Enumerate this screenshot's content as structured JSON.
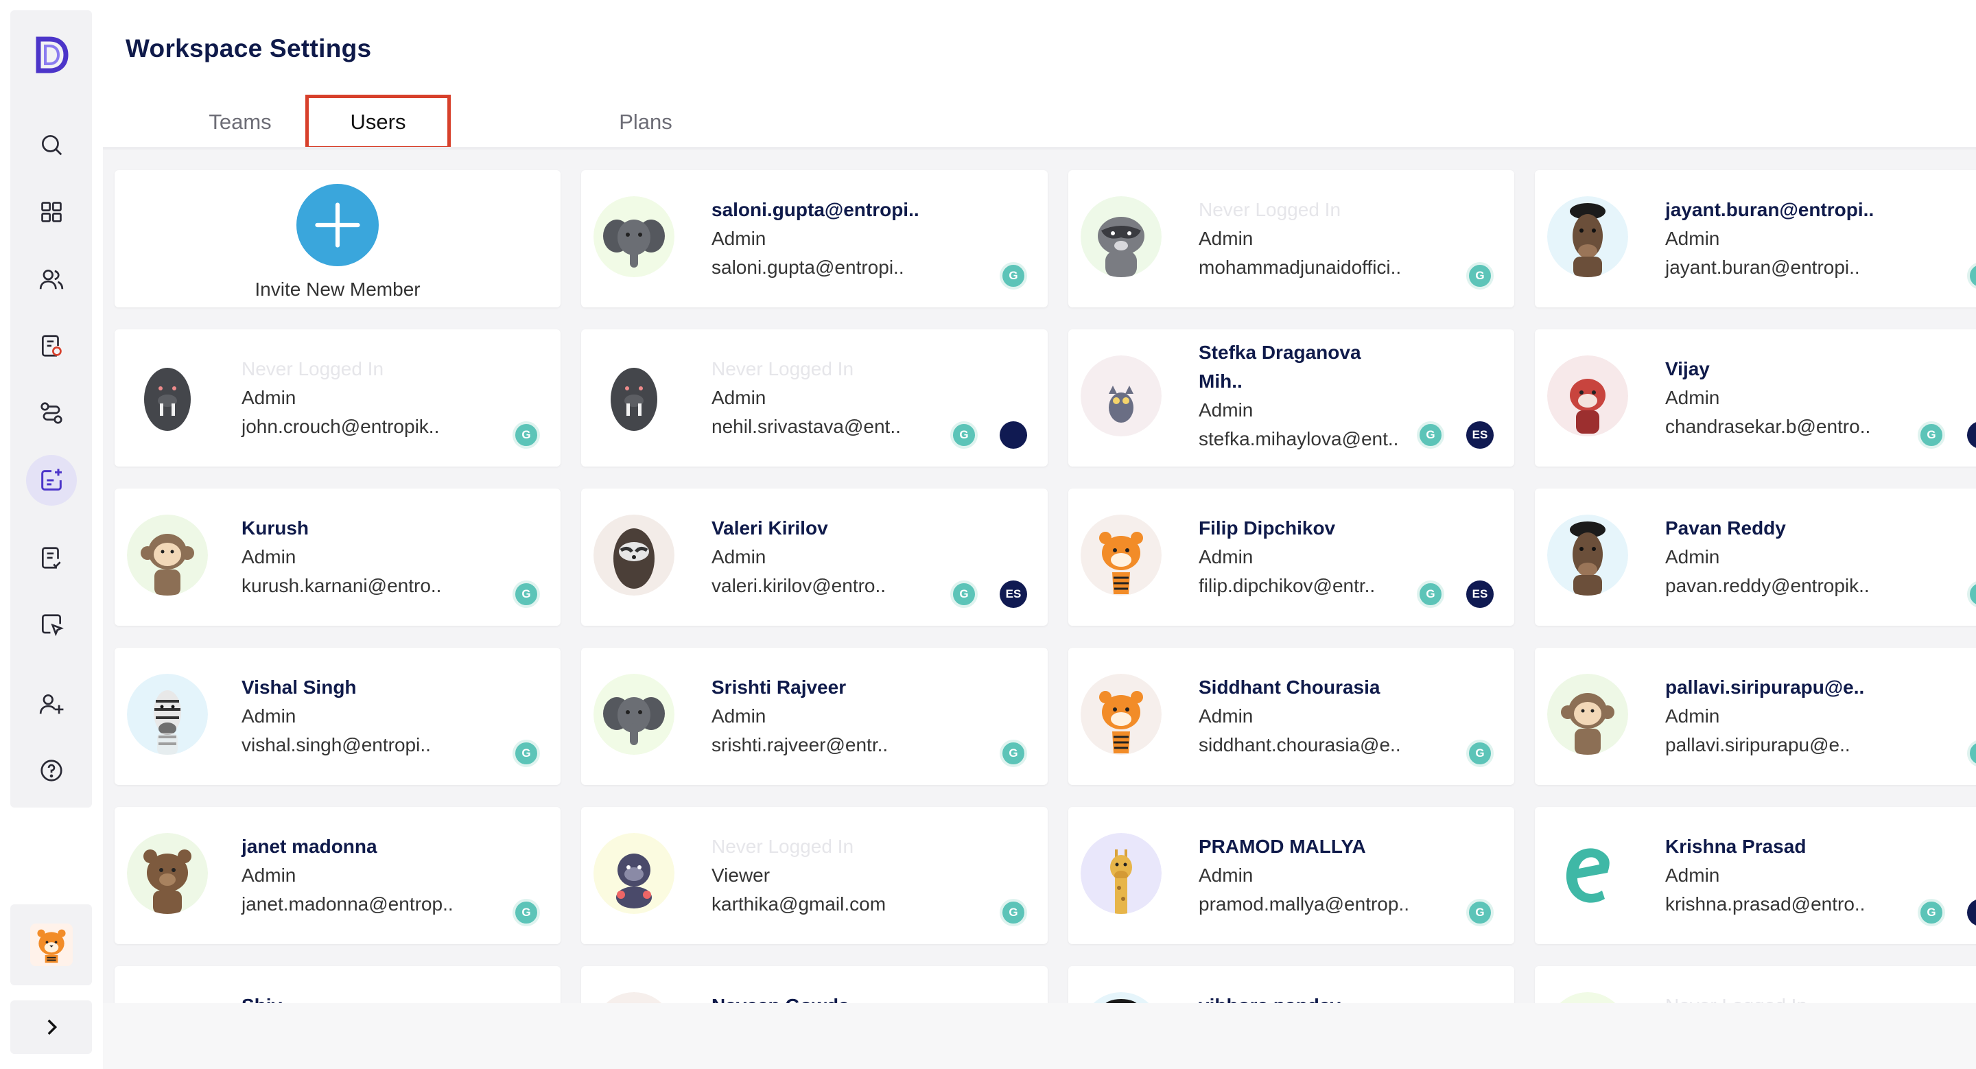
{
  "page": {
    "title": "Workspace Settings"
  },
  "tabs": [
    {
      "label": "Teams",
      "active": false
    },
    {
      "label": "Users",
      "active": true
    },
    {
      "label": "Plans",
      "active": false
    }
  ],
  "colors": {
    "accent": "#3aa6dc",
    "active_tab_border": "#d7402b",
    "title": "#0f1a4a",
    "badge_g": "#5cc4b8",
    "badge_dark": "#101a52"
  },
  "invite": {
    "label": "Invite New Member",
    "icon": "plus-icon"
  },
  "sidebar": {
    "icons": [
      "logo-d-icon",
      "search-icon",
      "grid-icon",
      "users-icon",
      "document-check-icon",
      "route-icon",
      "add-calendar-icon",
      "task-list-icon",
      "cursor-select-icon",
      "add-user-icon",
      "help-icon"
    ],
    "active": "add-calendar-icon",
    "expand_icon": "chevron-right-icon"
  },
  "users": [
    {
      "name": "saloni.gupta@entropi..",
      "role": "Admin",
      "email": "saloni.gupta@entropi..",
      "avatar": "elephant",
      "badges": [
        "G"
      ]
    },
    {
      "name": "Never Logged In",
      "never": true,
      "role": "Admin",
      "email": "mohammadjunaidoffici..",
      "avatar": "raccoon",
      "badges": [
        "G"
      ]
    },
    {
      "name": "jayant.buran@entropi..",
      "role": "Admin",
      "email": "jayant.buran@entropi..",
      "avatar": "horse",
      "badges": [
        "G"
      ]
    },
    {
      "name": "Never Logged In",
      "never": true,
      "role": "Admin",
      "email": "john.crouch@entropik..",
      "avatar": "walrus",
      "badges": [
        "G"
      ]
    },
    {
      "name": "Never Logged In",
      "never": true,
      "role": "Admin",
      "email": "nehil.srivastava@ent..",
      "avatar": "walrus",
      "badges": [
        "G",
        "dot"
      ]
    },
    {
      "name": "Stefka Draganova",
      "name2": "Mih..",
      "role": "Admin",
      "email": "stefka.mihaylova@ent..",
      "avatar": "owl",
      "badges": [
        "G",
        "ES"
      ]
    },
    {
      "name": "Vijay",
      "role": "Admin",
      "email": "chandrasekar.b@entro..",
      "avatar": "redpanda",
      "badges": [
        "G",
        "dot"
      ]
    },
    {
      "name": "Kurush",
      "role": "Admin",
      "email": "kurush.karnani@entro..",
      "avatar": "monkey",
      "badges": [
        "G"
      ]
    },
    {
      "name": "Valeri Kirilov",
      "role": "Admin",
      "email": "valeri.kirilov@entro..",
      "avatar": "sloth",
      "badges": [
        "G",
        "ES"
      ]
    },
    {
      "name": "Filip Dipchikov",
      "role": "Admin",
      "email": "filip.dipchikov@entr..",
      "avatar": "tiger",
      "badges": [
        "G",
        "ES"
      ]
    },
    {
      "name": "Pavan Reddy",
      "role": "Admin",
      "email": "pavan.reddy@entropik..",
      "avatar": "horse",
      "badges": [
        "G"
      ]
    },
    {
      "name": "Vishal Singh",
      "role": "Admin",
      "email": "vishal.singh@entropi..",
      "avatar": "zebra",
      "badges": [
        "G"
      ]
    },
    {
      "name": "Srishti Rajveer",
      "role": "Admin",
      "email": "srishti.rajveer@entr..",
      "avatar": "elephant",
      "badges": [
        "G"
      ]
    },
    {
      "name": "Siddhant Chourasia",
      "role": "Admin",
      "email": "siddhant.chourasia@e..",
      "avatar": "tiger",
      "badges": [
        "G"
      ]
    },
    {
      "name": "pallavi.siripurapu@e..",
      "role": "Admin",
      "email": "pallavi.siripurapu@e..",
      "avatar": "monkey",
      "badges": [
        "G"
      ]
    },
    {
      "name": "janet madonna",
      "role": "Admin",
      "email": "janet.madonna@entrop..",
      "avatar": "bear",
      "badges": [
        "G"
      ]
    },
    {
      "name": "Never Logged In",
      "never": true,
      "role": "Viewer",
      "email": "karthika@gmail.com",
      "avatar": "gorilla",
      "badges": [
        "G"
      ]
    },
    {
      "name": "PRAMOD MALLYA",
      "role": "Admin",
      "email": "pramod.mallya@entrop..",
      "avatar": "giraffe",
      "badges": [
        "G"
      ]
    },
    {
      "name": "Krishna Prasad",
      "role": "Admin",
      "email": "krishna.prasad@entro..",
      "avatar": "logo-e",
      "badges": [
        "G",
        "dot"
      ]
    },
    {
      "name": "Shiv",
      "role": "",
      "email": "",
      "avatar": "walrus",
      "badges": []
    },
    {
      "name": "Naveen Gowda",
      "role": "",
      "email": "",
      "avatar": "tiger",
      "badges": []
    },
    {
      "name": "vibhore pandey",
      "role": "",
      "email": "",
      "avatar": "horse",
      "badges": []
    },
    {
      "name": "Never Logged In",
      "never": true,
      "role": "",
      "email": "",
      "avatar": "elephant",
      "badges": []
    }
  ]
}
